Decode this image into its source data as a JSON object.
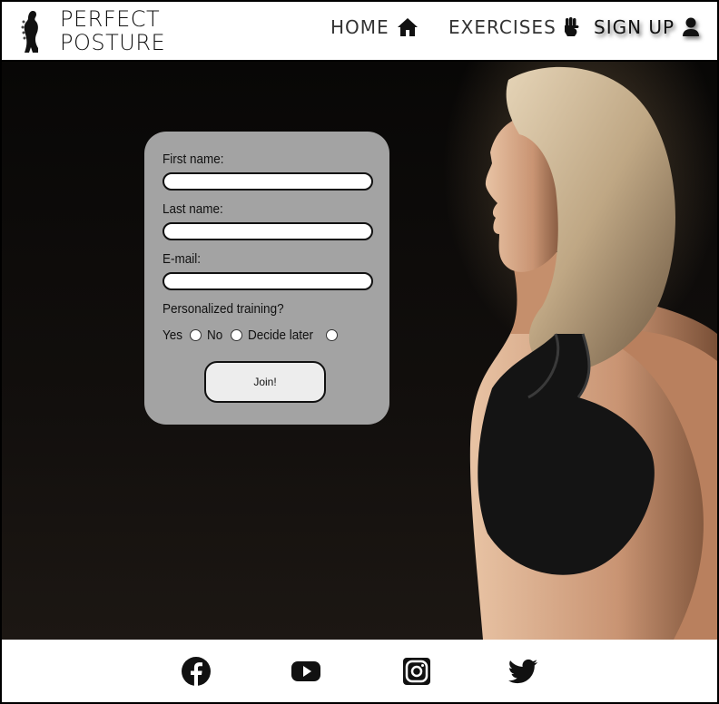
{
  "header": {
    "brand_line1": "PERFECT",
    "brand_line2": "POSTURE",
    "logo_icon": "spine-silhouette-icon",
    "nav": [
      {
        "label": "HOME",
        "icon": "home-icon"
      },
      {
        "label": "EXERCISES",
        "icon": "fist-icon"
      },
      {
        "label": "SIGN UP",
        "icon": "user-icon"
      }
    ]
  },
  "form": {
    "first_name_label": "First name:",
    "last_name_label": "Last name:",
    "email_label": "E-mail:",
    "first_name_value": "",
    "last_name_value": "",
    "email_value": "",
    "training_question": "Personalized training?",
    "options": [
      "Yes",
      "No",
      "Decide later"
    ],
    "submit_label": "Join!"
  },
  "hero": {
    "image": "woman-athlete-profile-photo"
  },
  "footer": {
    "social": [
      "facebook-icon",
      "youtube-icon",
      "instagram-icon",
      "twitter-icon"
    ]
  },
  "colors": {
    "card_bg": "#a3a3a3",
    "hero_bg": "#0b0908",
    "header_bg": "#ffffff"
  }
}
